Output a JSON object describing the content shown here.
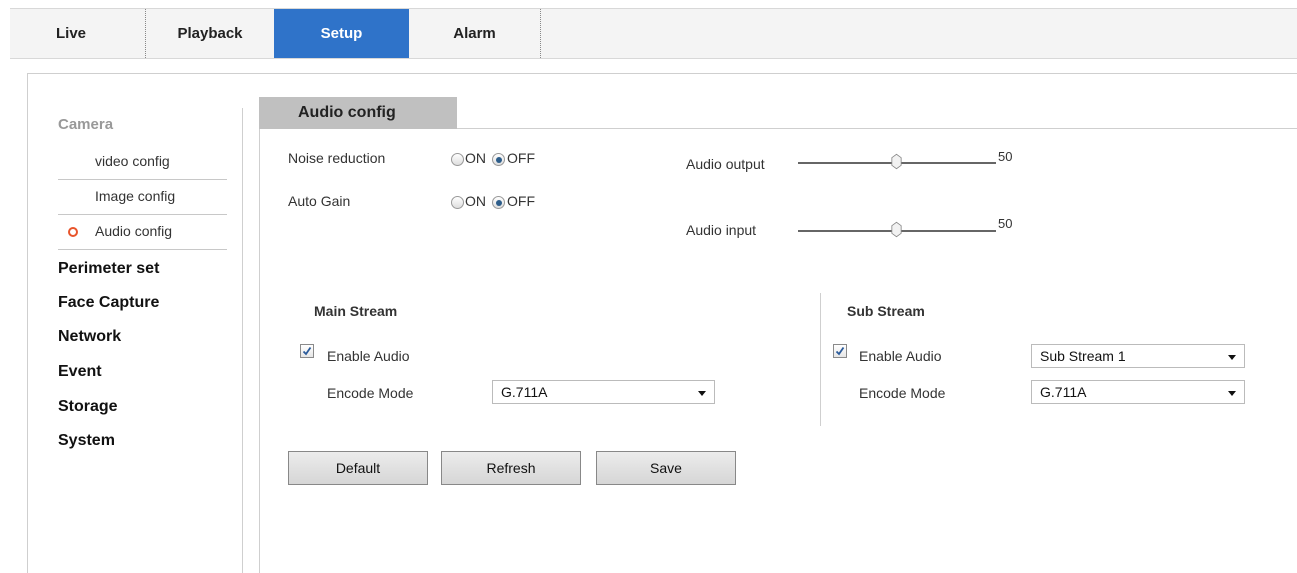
{
  "nav": {
    "tabs": [
      {
        "label": "Live"
      },
      {
        "label": "Playback"
      },
      {
        "label": "Setup"
      },
      {
        "label": "Alarm"
      }
    ]
  },
  "sidebar": {
    "camera_label": "Camera",
    "sub_items": [
      {
        "label": "video config"
      },
      {
        "label": "Image config"
      },
      {
        "label": "Audio config"
      }
    ],
    "items": [
      {
        "label": "Perimeter set"
      },
      {
        "label": "Face Capture"
      },
      {
        "label": "Network"
      },
      {
        "label": "Event"
      },
      {
        "label": "Storage"
      },
      {
        "label": "System"
      }
    ]
  },
  "content": {
    "tab_label": "Audio config",
    "noise_reduction": {
      "label": "Noise reduction",
      "on_label": "ON",
      "off_label": "OFF",
      "value": "OFF"
    },
    "auto_gain": {
      "label": "Auto Gain",
      "on_label": "ON",
      "off_label": "OFF",
      "value": "OFF"
    },
    "audio_output": {
      "label": "Audio output",
      "value": "50"
    },
    "audio_input": {
      "label": "Audio input",
      "value": "50"
    },
    "main_stream": {
      "title": "Main Stream",
      "enable_audio_label": "Enable Audio",
      "encode_mode_label": "Encode Mode",
      "encode_mode_value": "G.711A"
    },
    "sub_stream": {
      "title": "Sub Stream",
      "enable_audio_label": "Enable Audio",
      "stream_select_value": "Sub Stream 1",
      "encode_mode_label": "Encode Mode",
      "encode_mode_value": "G.711A"
    },
    "buttons": {
      "default_label": "Default",
      "refresh_label": "Refresh",
      "save_label": "Save"
    }
  },
  "colors": {
    "accent": "#2f73c9",
    "sidebar_sub": "#9b30c8",
    "active_dot": "#e8542b"
  }
}
